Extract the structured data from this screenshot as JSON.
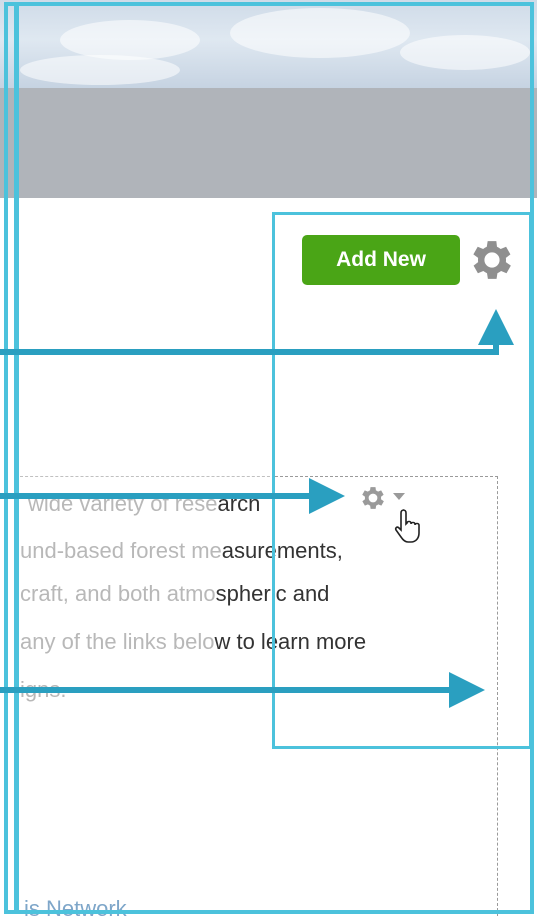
{
  "toolbar": {
    "add_new_label": "Add New",
    "settings_icon": "gear-icon"
  },
  "content": {
    "lines": [
      {
        "faded": "wide variety of rese",
        "dark": "arch"
      },
      {
        "faded": "und-based forest me",
        "dark": "asurements,"
      },
      {
        "faded": "craft, and both atmo",
        "dark": "spheric and"
      },
      {
        "faded": "any of the links belo",
        "dark": "w to learn more"
      },
      {
        "faded": "igns.",
        "dark": ""
      }
    ],
    "footer_link": "is Network"
  },
  "widget": {
    "settings_icon": "gear-icon",
    "dropdown_icon": "caret-down-icon",
    "cursor_icon": "hand-pointer-icon"
  },
  "colors": {
    "accent": "#4cc2dc",
    "arrow": "#2a9fc0",
    "button_green": "#4aa516",
    "header_gray": "#b0b4ba"
  }
}
